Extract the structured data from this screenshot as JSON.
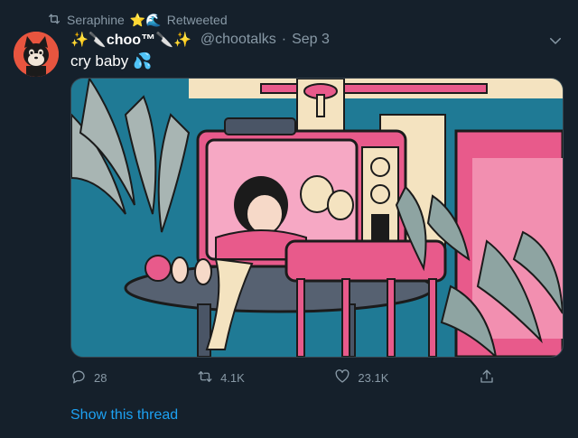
{
  "retweet": {
    "name": "Seraphine",
    "emoji": "⭐🌊",
    "label": "Retweeted",
    "icon": "retweet-icon"
  },
  "tweet": {
    "avatar_icon": "cat-avatar",
    "display_name": "✨🔪choo™🔪✨",
    "handle": "@chootalks",
    "dot": "·",
    "date": "Sep 3",
    "text": "cry baby 💦",
    "more_icon": "chevron-down-icon",
    "media_description_icon": "illustration"
  },
  "actions": {
    "reply": {
      "icon": "reply-icon",
      "count": "28"
    },
    "retweet": {
      "icon": "retweet-icon",
      "count": "4.1K"
    },
    "like": {
      "icon": "heart-icon",
      "count": "23.1K"
    },
    "share": {
      "icon": "share-icon"
    }
  },
  "thread_link": "Show this thread",
  "colors": {
    "background": "#15202b",
    "muted": "#8899a6",
    "accent": "#1da1f2"
  }
}
